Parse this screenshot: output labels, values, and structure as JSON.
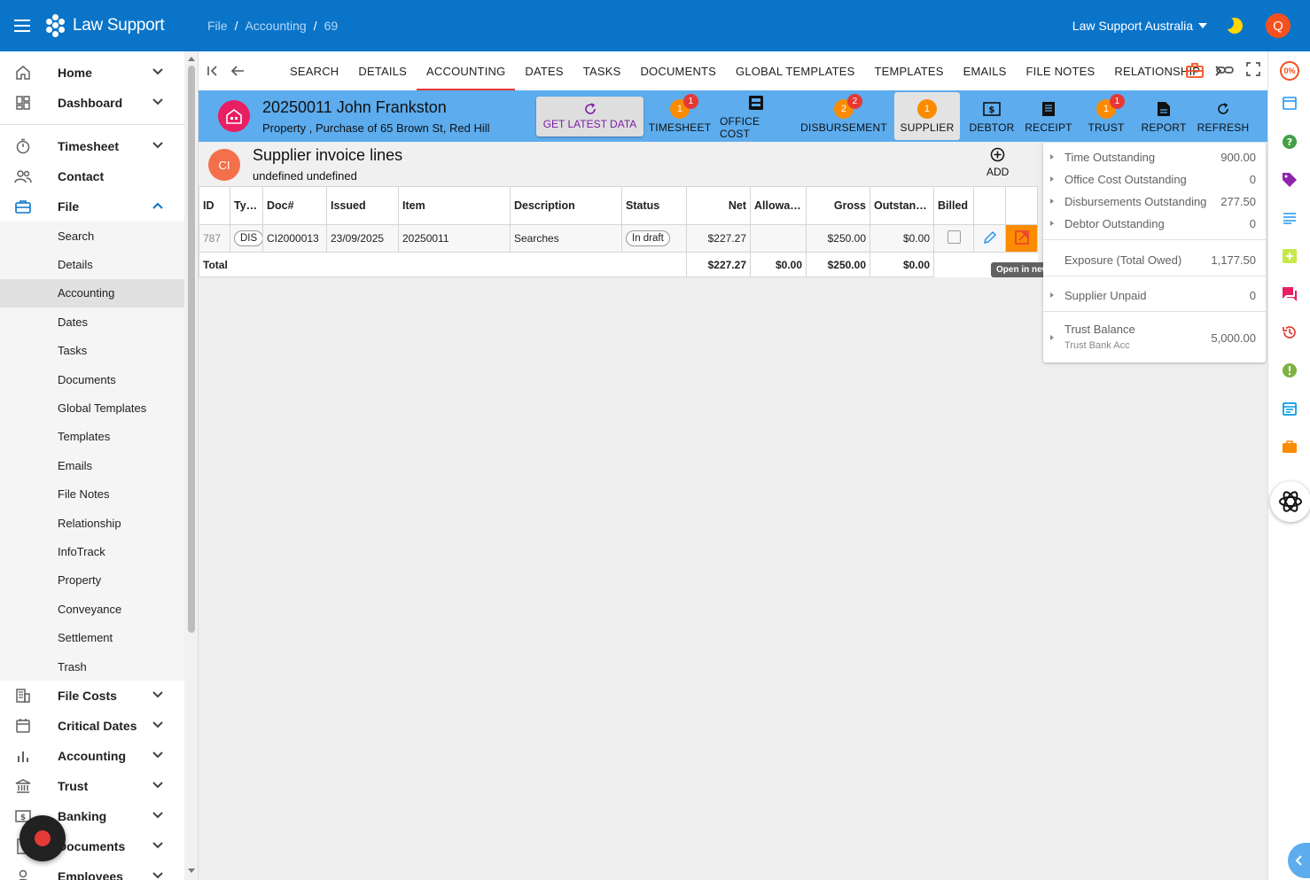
{
  "app": {
    "brand": "Law Support",
    "breadcrumb": [
      "File",
      "Accounting",
      "69"
    ],
    "org": "Law Support Australia",
    "user_initial": "Q"
  },
  "sidebar": {
    "top_items": [
      {
        "label": "Home",
        "icon": "home-icon"
      },
      {
        "label": "Dashboard",
        "icon": "dashboard-icon"
      }
    ],
    "mid_items": [
      {
        "label": "Timesheet",
        "icon": "stopwatch-icon"
      },
      {
        "label": "Contact",
        "icon": "people-icon"
      },
      {
        "label": "File",
        "icon": "briefcase-icon"
      }
    ],
    "file_sub": [
      "Search",
      "Details",
      "Accounting",
      "Dates",
      "Tasks",
      "Documents",
      "Global Templates",
      "Templates",
      "Emails",
      "File Notes",
      "Relationship",
      "InfoTrack",
      "Property",
      "Conveyance",
      "Settlement",
      "Trash"
    ],
    "bottom_items": [
      {
        "label": "File Costs",
        "icon": "building-icon"
      },
      {
        "label": "Critical Dates",
        "icon": "calendar-icon"
      },
      {
        "label": "Accounting",
        "icon": "bar-chart-icon"
      },
      {
        "label": "Trust",
        "icon": "bank-icon"
      },
      {
        "label": "Banking",
        "icon": "money-icon"
      },
      {
        "label": "Documents",
        "icon": "document-icon"
      },
      {
        "label": "Employees",
        "icon": "employee-icon"
      }
    ]
  },
  "tabs": [
    "SEARCH",
    "DETAILS",
    "ACCOUNTING",
    "DATES",
    "TASKS",
    "DOCUMENTS",
    "GLOBAL TEMPLATES",
    "TEMPLATES",
    "EMAILS",
    "FILE NOTES",
    "RELATIONSHIP"
  ],
  "file": {
    "title": "20250011 John Frankston",
    "subtitle": "Property , Purchase of 65 Brown St, Red Hill",
    "latest_label": "GET LATEST DATA"
  },
  "header_buttons": [
    {
      "label": "TIMESHEET",
      "count": "1",
      "alert": "1"
    },
    {
      "label": "OFFICE COST"
    },
    {
      "label": "DISBURSEMENT",
      "count": "2",
      "alert": "2"
    },
    {
      "label": "SUPPLIER",
      "count": "1"
    },
    {
      "label": "DEBTOR"
    },
    {
      "label": "RECEIPT"
    },
    {
      "label": "TRUST",
      "count": "1",
      "alert": "1"
    },
    {
      "label": "REPORT"
    },
    {
      "label": "REFRESH"
    }
  ],
  "supplier": {
    "initials": "CI",
    "title": "Supplier invoice lines",
    "subtitle": "undefined undefined",
    "add_label": "ADD"
  },
  "grid": {
    "columns": [
      "ID",
      "Type",
      "Doc#",
      "Issued",
      "Item",
      "Description",
      "Status",
      "Net",
      "Allowan...",
      "Gross",
      "Outstand...",
      "Billed"
    ],
    "rows": [
      {
        "id": "787",
        "type": "DIS",
        "doc": "CI2000013",
        "issued": "23/09/2025",
        "item": "20250011",
        "description": "Searches",
        "status": "In draft",
        "net": "$227.27",
        "allowance": "",
        "gross": "$250.00",
        "outstanding": "$0.00"
      }
    ],
    "total": {
      "label": "Total",
      "net": "$227.27",
      "allowance": "$0.00",
      "gross": "$250.00",
      "outstanding": "$0.00"
    },
    "tooltip": "Open in new"
  },
  "summary": {
    "rows": [
      {
        "label": "Time Outstanding",
        "value": "900.00"
      },
      {
        "label": "Office Cost Outstanding",
        "value": "0"
      },
      {
        "label": "Disbursements Outstanding",
        "value": "277.50"
      },
      {
        "label": "Debtor Outstanding",
        "value": "0"
      }
    ],
    "exposure": {
      "label": "Exposure (Total Owed)",
      "value": "1,177.50"
    },
    "supplier_unpaid": {
      "label": "Supplier Unpaid",
      "value": "0"
    },
    "trust": {
      "label": "Trust Balance",
      "sub": "Trust Bank Acc",
      "value": "5,000.00"
    }
  },
  "rail": {
    "percent": "0%"
  },
  "colors": {
    "primary": "#0a74c9",
    "header_strip": "#5cacee",
    "accent_red": "#e53935",
    "badge_orange": "#fb8c00"
  }
}
